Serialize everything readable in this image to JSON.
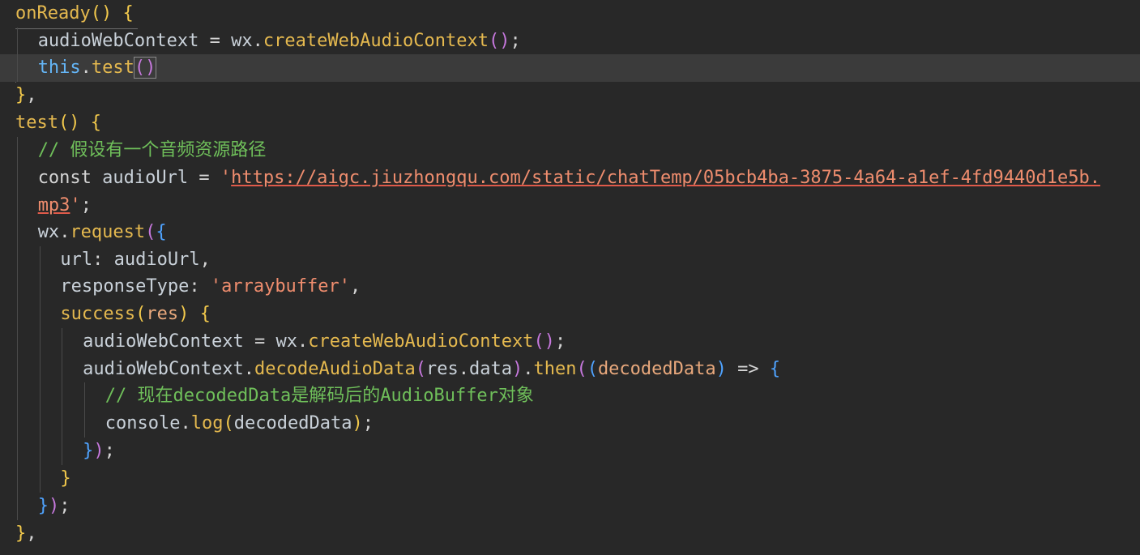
{
  "editor": {
    "lines": [
      {
        "tokens": [
          [
            "func",
            "onReady"
          ],
          [
            "br1",
            "()"
          ],
          [
            "plain",
            " "
          ],
          [
            "br1",
            "{"
          ]
        ]
      },
      {
        "tokens": [
          [
            "var",
            "audioWebContext"
          ],
          [
            "op",
            " = "
          ],
          [
            "var",
            "wx"
          ],
          [
            "plain",
            "."
          ],
          [
            "func",
            "createWebAudioContext"
          ],
          [
            "br2",
            "()"
          ],
          [
            "plain",
            ";"
          ]
        ]
      },
      {
        "tokens": [
          [
            "this",
            "this"
          ],
          [
            "plain",
            "."
          ],
          [
            "func",
            "test"
          ],
          [
            "br2",
            "()"
          ]
        ]
      },
      {
        "tokens": [
          [
            "br1",
            "}"
          ],
          [
            "plain",
            ","
          ]
        ]
      },
      {
        "tokens": [
          [
            "func",
            "test"
          ],
          [
            "br1",
            "()"
          ],
          [
            "plain",
            " "
          ],
          [
            "br1",
            "{"
          ]
        ]
      },
      {
        "tokens": [
          [
            "cmt",
            "// 假设有一个音频资源路径"
          ]
        ]
      },
      {
        "tokens": [
          [
            "kw",
            "const"
          ],
          [
            "plain",
            " "
          ],
          [
            "var",
            "audioUrl"
          ],
          [
            "op",
            " = "
          ],
          [
            "str",
            "'"
          ],
          [
            "url",
            "https://aigc.jiuzhongqu.com/static/chatTemp/05bcb4ba-3875-4a64-a1ef-4fd9440d1e5b."
          ]
        ]
      },
      {
        "tokens": [
          [
            "url",
            "mp3"
          ],
          [
            "str",
            "'"
          ],
          [
            "plain",
            ";"
          ]
        ]
      },
      {
        "tokens": [
          [
            "var",
            "wx"
          ],
          [
            "plain",
            "."
          ],
          [
            "func",
            "request"
          ],
          [
            "br2",
            "("
          ],
          [
            "br3",
            "{"
          ]
        ]
      },
      {
        "tokens": [
          [
            "var",
            "url"
          ],
          [
            "plain",
            ": "
          ],
          [
            "var",
            "audioUrl"
          ],
          [
            "plain",
            ","
          ]
        ]
      },
      {
        "tokens": [
          [
            "var",
            "responseType"
          ],
          [
            "plain",
            ": "
          ],
          [
            "str",
            "'arraybuffer'"
          ],
          [
            "plain",
            ","
          ]
        ]
      },
      {
        "tokens": [
          [
            "func",
            "success"
          ],
          [
            "br1",
            "("
          ],
          [
            "param",
            "res"
          ],
          [
            "br1",
            ")"
          ],
          [
            "plain",
            " "
          ],
          [
            "br1",
            "{"
          ]
        ]
      },
      {
        "tokens": [
          [
            "var",
            "audioWebContext"
          ],
          [
            "op",
            " = "
          ],
          [
            "var",
            "wx"
          ],
          [
            "plain",
            "."
          ],
          [
            "func",
            "createWebAudioContext"
          ],
          [
            "br2",
            "()"
          ],
          [
            "plain",
            ";"
          ]
        ]
      },
      {
        "tokens": [
          [
            "var",
            "audioWebContext"
          ],
          [
            "plain",
            "."
          ],
          [
            "func",
            "decodeAudioData"
          ],
          [
            "br2",
            "("
          ],
          [
            "var",
            "res"
          ],
          [
            "plain",
            "."
          ],
          [
            "var",
            "data"
          ],
          [
            "br2",
            ")"
          ],
          [
            "plain",
            "."
          ],
          [
            "func",
            "then"
          ],
          [
            "br2",
            "("
          ],
          [
            "br3",
            "("
          ],
          [
            "param",
            "decodedData"
          ],
          [
            "br3",
            ")"
          ],
          [
            "op",
            " => "
          ],
          [
            "br3",
            "{"
          ]
        ]
      },
      {
        "tokens": [
          [
            "cmt",
            "// 现在decodedData是解码后的AudioBuffer对象"
          ]
        ]
      },
      {
        "tokens": [
          [
            "var",
            "console"
          ],
          [
            "plain",
            "."
          ],
          [
            "func",
            "log"
          ],
          [
            "br1",
            "("
          ],
          [
            "var",
            "decodedData"
          ],
          [
            "br1",
            ")"
          ],
          [
            "plain",
            ";"
          ]
        ]
      },
      {
        "tokens": [
          [
            "br3",
            "}"
          ],
          [
            "br2",
            ")"
          ],
          [
            "plain",
            ";"
          ]
        ]
      },
      {
        "tokens": [
          [
            "br1",
            "}"
          ]
        ]
      },
      {
        "tokens": [
          [
            "br3",
            "}"
          ],
          [
            "br2",
            ")"
          ],
          [
            "plain",
            ";"
          ]
        ]
      },
      {
        "tokens": [
          [
            "br1",
            "}"
          ],
          [
            "plain",
            ","
          ]
        ]
      }
    ]
  },
  "colors": {
    "background": "#282828",
    "active_line": "#3b3b3b",
    "function": "#e5b94f",
    "string": "#ef8d6e",
    "comment": "#6fbf5a",
    "this_keyword": "#64b5f6"
  }
}
